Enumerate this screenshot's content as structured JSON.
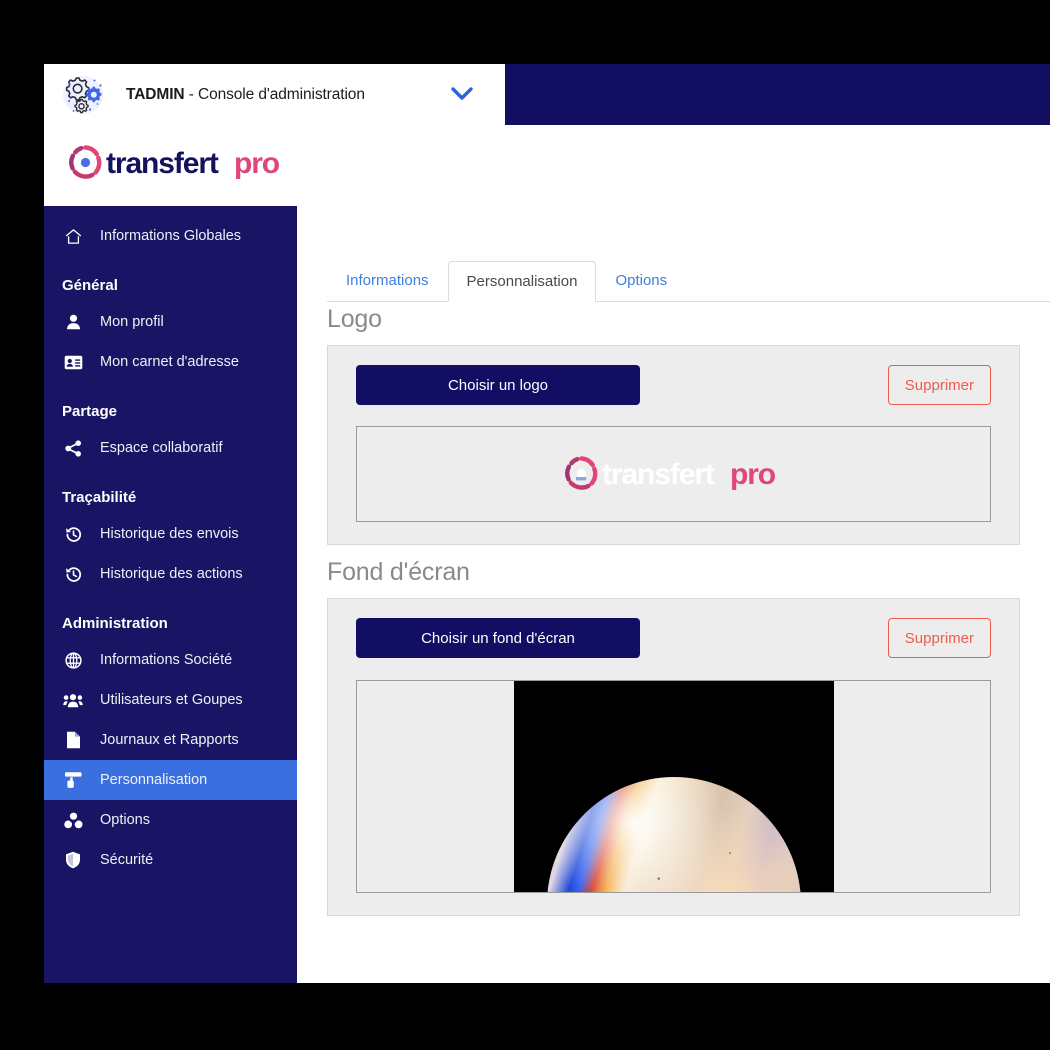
{
  "header": {
    "product_prefix": "TADMIN",
    "product_title": " - Console d'administration",
    "gears_icon": "gears-icon",
    "chevron_icon": "chevron-down-icon"
  },
  "brand": {
    "name_part1": "transfert",
    "name_part2": "pro",
    "mark_icon": "transfertpro-mark-icon"
  },
  "sidebar": {
    "top_item": {
      "label": "Informations Globales",
      "icon": "home-icon"
    },
    "groups": [
      {
        "title": "Général",
        "items": [
          {
            "label": "Mon profil",
            "icon": "user-icon"
          },
          {
            "label": "Mon carnet d'adresse",
            "icon": "address-card-icon"
          }
        ]
      },
      {
        "title": "Partage",
        "items": [
          {
            "label": "Espace collaboratif",
            "icon": "share-icon"
          }
        ]
      },
      {
        "title": "Traçabilité",
        "items": [
          {
            "label": "Historique des envois",
            "icon": "history-icon"
          },
          {
            "label": "Historique des actions",
            "icon": "history-icon"
          }
        ]
      },
      {
        "title": "Administration",
        "items": [
          {
            "label": "Informations Société",
            "icon": "globe-icon"
          },
          {
            "label": "Utilisateurs et Goupes",
            "icon": "users-icon"
          },
          {
            "label": "Journaux et Rapports",
            "icon": "document-icon"
          },
          {
            "label": "Personnalisation",
            "icon": "paint-roller-icon",
            "active": true
          },
          {
            "label": "Options",
            "icon": "cubes-icon"
          },
          {
            "label": "Sécurité",
            "icon": "shield-icon"
          }
        ]
      }
    ]
  },
  "tabs": [
    {
      "label": "Informations",
      "active": false
    },
    {
      "label": "Personnalisation",
      "active": true
    },
    {
      "label": "Options",
      "active": false
    }
  ],
  "sections": {
    "logo": {
      "title": "Logo",
      "choose_label": "Choisir un logo",
      "delete_label": "Supprimer",
      "preview": "transfertpro-logo-preview"
    },
    "wallpaper": {
      "title": "Fond d'écran",
      "choose_label": "Choisir un fond d'écran",
      "delete_label": "Supprimer",
      "preview": "iridescent-bubble-sphere-on-black"
    }
  },
  "colors": {
    "navy": "#120e63",
    "sidebar": "#191464",
    "active_nav": "#3a6fe0",
    "link_blue": "#3d7fe0",
    "danger_red": "#ec5c4e",
    "brand_pink": "#e0457b",
    "panel_gray": "#ededed"
  }
}
